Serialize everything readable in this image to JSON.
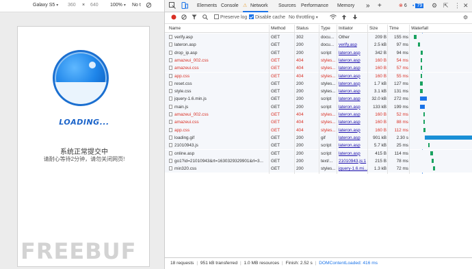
{
  "device_toolbar": {
    "device_name": "Galaxy S5",
    "width": "360",
    "times": "×",
    "height": "640",
    "zoom": "100%",
    "throttle": "No t"
  },
  "page": {
    "loading_text": "LOADING...",
    "message_title": "系统正常提交中",
    "message_sub": "请耐心等待2分钟，请勿关闭网页!"
  },
  "watermark": "FREEBUF",
  "devtools": {
    "tabs": [
      "Elements",
      "Console",
      "Network",
      "Sources",
      "Performance",
      "Memory"
    ],
    "active_tab": "Network",
    "more": "»",
    "add": "+",
    "error_count": "6",
    "message_count": "79"
  },
  "network_toolbar": {
    "preserve_log": "Preserve log",
    "disable_cache": "Disable cache",
    "throttling": "No throttling"
  },
  "columns": [
    "Name",
    "Method",
    "Status",
    "Type",
    "Initiator",
    "Size",
    "Time",
    "Waterfall"
  ],
  "requests": [
    {
      "name": "verify.asp",
      "method": "GET",
      "status": "302",
      "type": "docu...",
      "initiator": "Other",
      "size": "209 B",
      "time": "155 ms",
      "error": false,
      "wf_start": 0.02,
      "wf_len": 0.05,
      "wf_color": "#1aa260"
    },
    {
      "name": "lateron.asp",
      "method": "GET",
      "status": "200",
      "type": "docu...",
      "initiator": "verify.asp",
      "size": "2.5 kB",
      "time": "97 ms",
      "error": false,
      "wf_start": 0.09,
      "wf_len": 0.04,
      "wf_color": "#1aa260"
    },
    {
      "name": "drop_ip.asp",
      "method": "GET",
      "status": "200",
      "type": "script",
      "initiator": "lateron.asp",
      "size": "342 B",
      "time": "94 ms",
      "error": false,
      "wf_start": 0.14,
      "wf_len": 0.03,
      "wf_color": "#1aa260"
    },
    {
      "name": "amazeui_002.css",
      "method": "GET",
      "status": "404",
      "type": "styles...",
      "initiator": "lateron.asp",
      "size": "160 B",
      "time": "54 ms",
      "error": true,
      "wf_start": 0.14,
      "wf_len": 0.02,
      "wf_color": "#1aa260"
    },
    {
      "name": "amazeui.css",
      "method": "GET",
      "status": "404",
      "type": "styles...",
      "initiator": "lateron.asp",
      "size": "160 B",
      "time": "57 ms",
      "error": true,
      "wf_start": 0.14,
      "wf_len": 0.02,
      "wf_color": "#1aa260"
    },
    {
      "name": "app.css",
      "method": "GET",
      "status": "404",
      "type": "styles...",
      "initiator": "lateron.asp",
      "size": "160 B",
      "time": "55 ms",
      "error": true,
      "wf_start": 0.14,
      "wf_len": 0.02,
      "wf_color": "#1aa260"
    },
    {
      "name": "reset.css",
      "method": "GET",
      "status": "200",
      "type": "styles...",
      "initiator": "lateron.asp",
      "size": "1.7 kB",
      "time": "127 ms",
      "error": false,
      "wf_start": 0.12,
      "wf_len": 0.05,
      "wf_color": "#1aa260"
    },
    {
      "name": "style.css",
      "method": "GET",
      "status": "200",
      "type": "styles...",
      "initiator": "lateron.asp",
      "size": "3.1 kB",
      "time": "131 ms",
      "error": false,
      "wf_start": 0.12,
      "wf_len": 0.05,
      "wf_color": "#1aa260"
    },
    {
      "name": "jquery-1.6.min.js",
      "method": "GET",
      "status": "200",
      "type": "script",
      "initiator": "lateron.asp",
      "size": "32.0 kB",
      "time": "272 ms",
      "error": false,
      "wf_start": 0.12,
      "wf_len": 0.12,
      "wf_color": "#1a73e8"
    },
    {
      "name": "main.js",
      "method": "GET",
      "status": "200",
      "type": "script",
      "initiator": "lateron.asp",
      "size": "133 kB",
      "time": "199 ms",
      "error": false,
      "wf_start": 0.12,
      "wf_len": 0.08,
      "wf_color": "#1a73e8"
    },
    {
      "name": "amazeui_002.css",
      "method": "GET",
      "status": "404",
      "type": "styles...",
      "initiator": "lateron.asp",
      "size": "160 B",
      "time": "52 ms",
      "error": true,
      "wf_start": 0.18,
      "wf_len": 0.02,
      "wf_color": "#1aa260"
    },
    {
      "name": "amazeui.css",
      "method": "GET",
      "status": "404",
      "type": "styles...",
      "initiator": "lateron.asp",
      "size": "160 B",
      "time": "88 ms",
      "error": true,
      "wf_start": 0.18,
      "wf_len": 0.03,
      "wf_color": "#1aa260"
    },
    {
      "name": "app.css",
      "method": "GET",
      "status": "404",
      "type": "styles...",
      "initiator": "lateron.asp",
      "size": "160 B",
      "time": "112 ms",
      "error": true,
      "wf_start": 0.18,
      "wf_len": 0.04,
      "wf_color": "#1aa260"
    },
    {
      "name": "loading.gif",
      "method": "GET",
      "status": "200",
      "type": "gif",
      "initiator": "lateron.asp",
      "size": "901 kB",
      "time": "2.30 s",
      "error": false,
      "wf_start": 0.2,
      "wf_len": 0.8,
      "wf_color": "#1a8fd6"
    },
    {
      "name": "21010943.js",
      "method": "GET",
      "status": "200",
      "type": "script",
      "initiator": "lateron.asp",
      "size": "5.7 kB",
      "time": "25 ms",
      "error": false,
      "wf_start": 0.26,
      "wf_len": 0.02,
      "wf_color": "#1aa260"
    },
    {
      "name": "online.asp",
      "method": "GET",
      "status": "200",
      "type": "script",
      "initiator": "lateron.asp",
      "size": "415 B",
      "time": "114 ms",
      "error": false,
      "wf_start": 0.3,
      "wf_len": 0.04,
      "wf_color": "#1aa260"
    },
    {
      "name": "go1?id=21010943&rt=1630329329901&rl=3...",
      "method": "GET",
      "status": "200",
      "type": "text/...",
      "initiator": "21010943.js:1",
      "size": "215 B",
      "time": "78 ms",
      "error": false,
      "wf_start": 0.32,
      "wf_len": 0.03,
      "wf_color": "#1aa260"
    },
    {
      "name": "min320.css",
      "method": "GET",
      "status": "200",
      "type": "styles...",
      "initiator": "jquery-1.6.mi...",
      "size": "1.3 kB",
      "time": "72 ms",
      "error": false,
      "wf_start": 0.34,
      "wf_len": 0.03,
      "wf_color": "#1aa260"
    }
  ],
  "status_bar": {
    "requests": "18 requests",
    "transferred": "951 kB transferred",
    "resources": "1.0 MB resources",
    "finish": "Finish: 2.52 s",
    "dom": "DOMContentLoaded: 416 ms"
  },
  "colors": {
    "error": "#d93025",
    "link": "#1a0dab",
    "accent": "#1a73e8"
  }
}
